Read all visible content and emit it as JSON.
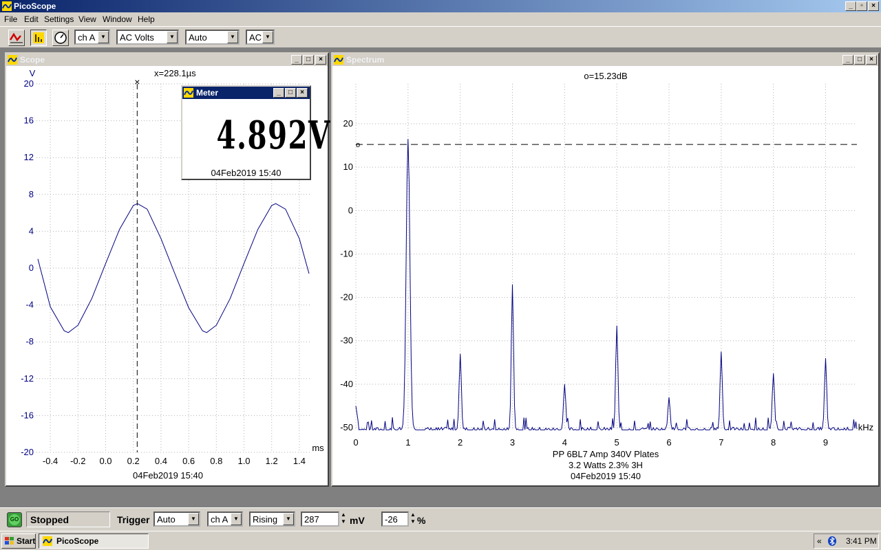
{
  "app": {
    "title": "PicoScope"
  },
  "menu": {
    "items": [
      "File",
      "Edit",
      "Settings",
      "View",
      "Window",
      "Help"
    ]
  },
  "toolbar": {
    "channel": "ch A",
    "mode": "AC Volts",
    "range": "Auto",
    "coupling": "AC"
  },
  "scope": {
    "title": "Scope",
    "y_unit": "V",
    "x_unit": "ms",
    "cursor_label": "x=228.1µs",
    "timestamp": "04Feb2019  15:40",
    "y_ticks": [
      "20",
      "16",
      "12",
      "8",
      "4",
      "0",
      "-4",
      "-8",
      "-12",
      "-16",
      "-20"
    ],
    "x_ticks": [
      "-0.4",
      "-0.2",
      "0.0",
      "0.2",
      "0.4",
      "0.6",
      "0.8",
      "1.0",
      "1.2",
      "1.4"
    ]
  },
  "meter": {
    "title": "Meter",
    "reading": "4.892V",
    "timestamp": "04Feb2019  15:40"
  },
  "spectrum": {
    "title": "Spectrum",
    "cursor_label": "o=15.23dB",
    "cursor_marker": "o",
    "x_unit": "kHz",
    "y_ticks": [
      "20",
      "10",
      "0",
      "-10",
      "-20",
      "-30",
      "-40",
      "-50"
    ],
    "x_ticks": [
      "0",
      "1",
      "2",
      "3",
      "4",
      "5",
      "6",
      "7",
      "8",
      "9"
    ],
    "notes": [
      "PP 6BL7  Amp 340V Plates",
      "3.2 Watts 2.3% 3H",
      "04Feb2019  15:40"
    ]
  },
  "status": {
    "run_button": "GO",
    "state": "Stopped",
    "trigger_label": "Trigger",
    "trigger_mode": "Auto",
    "trigger_channel": "ch A",
    "trigger_edge": "Rising",
    "trigger_level": "287",
    "level_unit": "mV",
    "pre_trigger": "-26",
    "pre_unit": "%"
  },
  "taskbar": {
    "start": "Start",
    "task": "PicoScope",
    "tray_arrows": "«",
    "clock": "3:41 PM"
  },
  "chart_data": [
    {
      "type": "line",
      "title": "",
      "xlabel": "ms",
      "ylabel": "V",
      "xlim": [
        -0.5,
        1.48
      ],
      "ylim": [
        -20,
        20
      ],
      "series": [
        {
          "x": [
            -0.49,
            -0.4,
            -0.3,
            -0.27,
            -0.2,
            -0.1,
            0.0,
            0.1,
            0.2,
            0.23,
            0.3,
            0.4,
            0.5,
            0.6,
            0.7,
            0.73,
            0.8,
            0.9,
            1.0,
            1.1,
            1.2,
            1.23,
            1.3,
            1.4,
            1.47
          ],
          "y": [
            1.0,
            -4.2,
            -6.8,
            -7.0,
            -6.2,
            -3.3,
            0.5,
            4.2,
            6.8,
            7.0,
            6.4,
            3.2,
            -0.6,
            -4.3,
            -6.8,
            -7.0,
            -6.2,
            -3.3,
            0.5,
            4.2,
            6.8,
            7.0,
            6.4,
            3.2,
            -0.6
          ]
        }
      ],
      "cursor_x": 0.228
    },
    {
      "type": "line",
      "title": "",
      "xlabel": "kHz",
      "ylabel": "",
      "xlim": [
        0,
        9.6
      ],
      "ylim": [
        -52,
        28
      ],
      "reference_level": 15.23,
      "peaks": [
        {
          "x": 1.0,
          "y": 16.5
        },
        {
          "x": 2.0,
          "y": -33
        },
        {
          "x": 3.0,
          "y": -17
        },
        {
          "x": 4.0,
          "y": -40
        },
        {
          "x": 5.0,
          "y": -26.5
        },
        {
          "x": 6.0,
          "y": -43
        },
        {
          "x": 7.0,
          "y": -32.5
        },
        {
          "x": 8.0,
          "y": -37.5
        },
        {
          "x": 9.0,
          "y": -34
        }
      ],
      "noise_floor": -50.5
    }
  ]
}
